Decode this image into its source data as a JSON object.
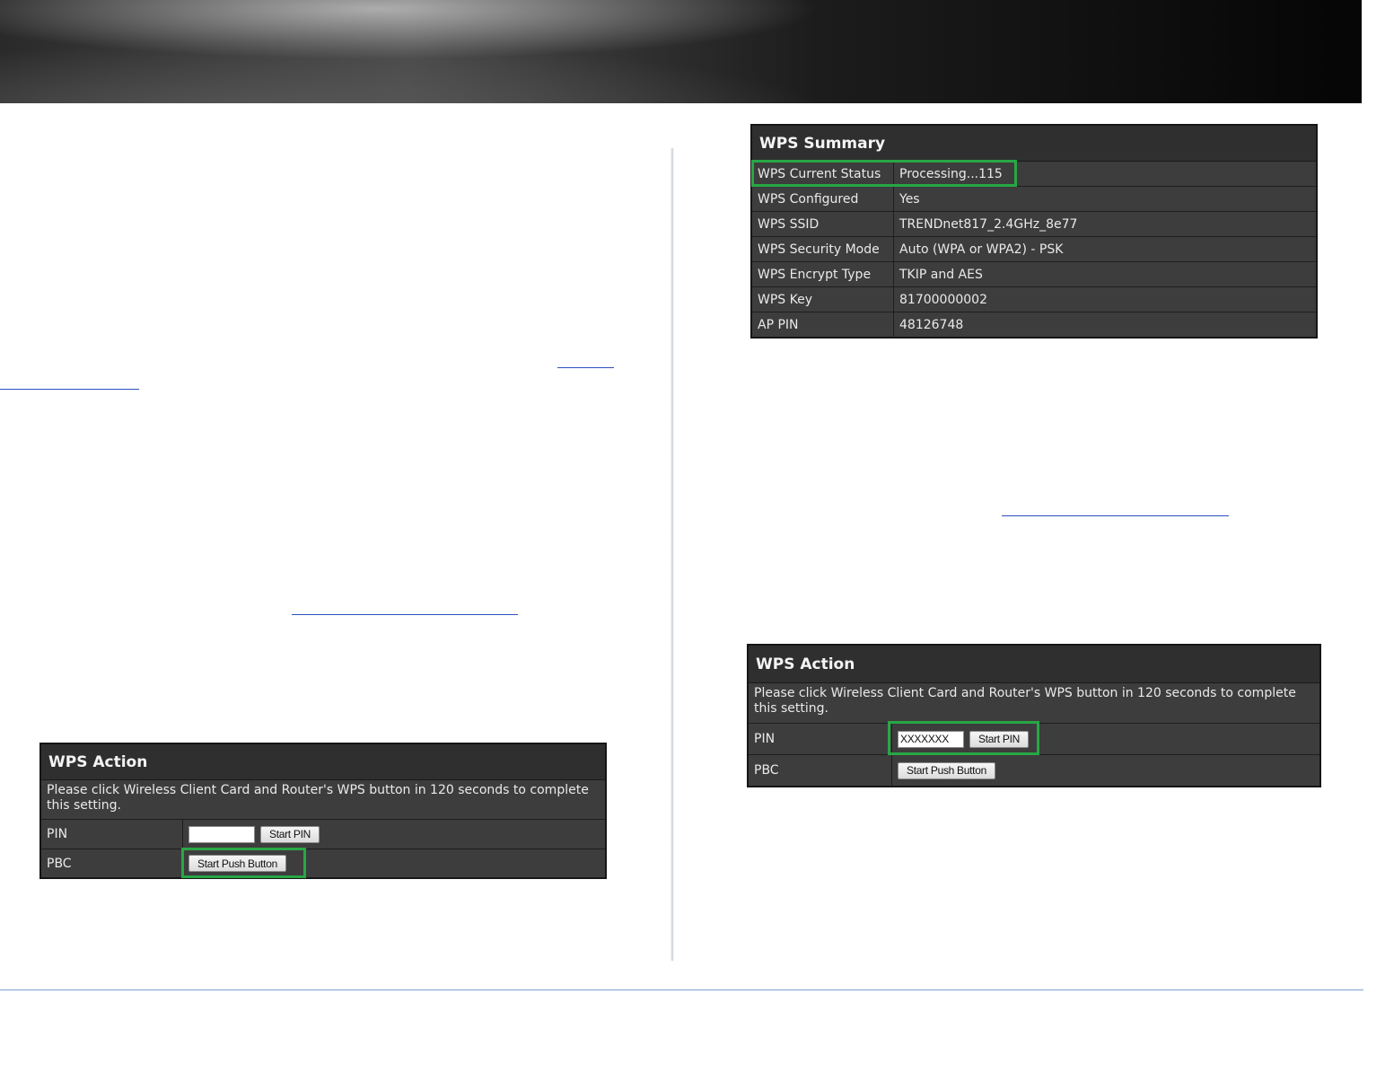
{
  "summary": {
    "title": "WPS Summary",
    "rows": [
      {
        "label": "WPS Current Status",
        "value": "Processing...115"
      },
      {
        "label": "WPS Configured",
        "value": "Yes"
      },
      {
        "label": "WPS SSID",
        "value": "TRENDnet817_2.4GHz_8e77"
      },
      {
        "label": "WPS Security Mode",
        "value": "Auto (WPA or WPA2) - PSK"
      },
      {
        "label": "WPS Encrypt Type",
        "value": "TKIP and AES"
      },
      {
        "label": "WPS Key",
        "value": "81700000002"
      },
      {
        "label": "AP PIN",
        "value": "48126748"
      }
    ]
  },
  "action_left": {
    "title": "WPS Action",
    "message": "Please click Wireless Client Card and Router's WPS button in 120 seconds to complete this setting.",
    "pin_label": "PIN",
    "pin_value": "",
    "start_pin_label": "Start PIN",
    "pbc_label": "PBC",
    "start_push_label": "Start Push Button"
  },
  "action_right": {
    "title": "WPS Action",
    "message": "Please click Wireless Client Card and Router's WPS button in 120 seconds to complete this setting.",
    "pin_label": "PIN",
    "pin_value": "XXXXXXX",
    "start_pin_label": "Start PIN",
    "pbc_label": "PBC",
    "start_push_label": "Start Push Button"
  },
  "colors": {
    "highlight": "#28a745",
    "panel_bg": "#3d3d3d",
    "link": "#2b4fbf"
  }
}
